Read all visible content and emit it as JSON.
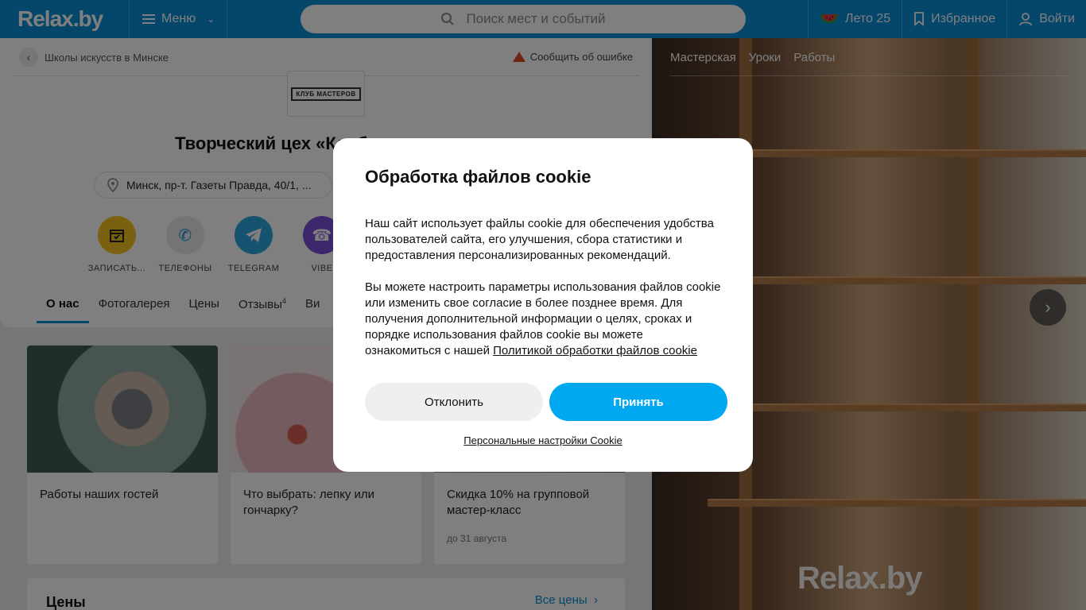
{
  "header": {
    "logo": "Relax.by",
    "menu_label": "Меню",
    "search_placeholder": "Поиск мест и событий",
    "summer_label": "Лето 25",
    "favorites_label": "Избранное",
    "login_label": "Войти"
  },
  "page": {
    "breadcrumb": "Школы искусств в Минске",
    "report": "Сообщить об ошибке",
    "logo_text": "КЛУБ МАСТЕРОВ",
    "title": "Творческий цех «Клуб",
    "address": "Минск, пр-т. Газеты Правда, 40/1, ...",
    "actions": [
      {
        "label": "ЗАПИСАТЬ...",
        "color": "#f4c21f"
      },
      {
        "label": "ТЕЛЕФОНЫ",
        "color": "#e8e8e8"
      },
      {
        "label": "TELEGRAM",
        "color": "#2aa6e0"
      },
      {
        "label": "VIBE",
        "color": "#7b4fd6"
      }
    ],
    "tabs": [
      "О нас",
      "Фотогалерея",
      "Цены",
      "Отзывы",
      "Ви"
    ],
    "reviews_count": "4",
    "tiles": [
      {
        "title": "Работы наших гостей",
        "sub": ""
      },
      {
        "title": "Что выбрать: лепку или гончарку?",
        "sub": ""
      },
      {
        "title": "Скидка 10% на групповой мастер-класс",
        "sub": "до 31 августа"
      }
    ],
    "prices_heading": "Цены",
    "prices_all": "Все цены"
  },
  "photo": {
    "tabs": [
      "Мастерская",
      "Уроки",
      "Работы"
    ],
    "watermark": "Relax.by"
  },
  "cookie": {
    "title": "Обработка файлов cookie",
    "para1": "Наш сайт использует файлы cookie для обеспечения удобства пользователей сайта, его улучшения, сбора статистики и предоставления персонализированных рекомендаций.",
    "para2": "Вы можете настроить параметры использования файлов cookie или изменить свое согласие в более позднее время. Для получения дополнительной информации о целях, сроках и порядке использования файлов cookie вы можете ознакомиться с нашей",
    "policy_link": "Политикой обработки файлов cookie",
    "decline": "Отклонить",
    "accept": "Принять",
    "personal": "Персональные настройки Cookie"
  }
}
